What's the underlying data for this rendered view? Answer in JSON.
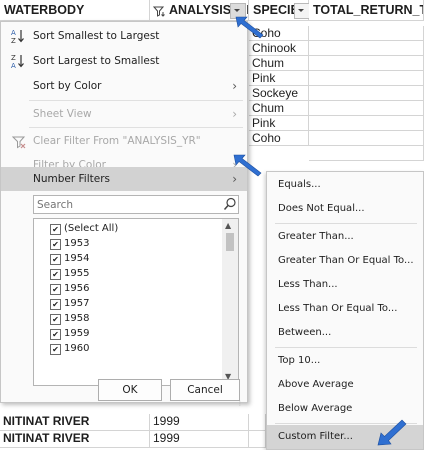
{
  "columns": [
    {
      "name": "WATERBODY"
    },
    {
      "name": "ANALYSIS_YR"
    },
    {
      "name": "SPECIES"
    },
    {
      "name": "TOTAL_RETURN_TO"
    }
  ],
  "species_cells": [
    "Coho",
    "Chinook",
    "Chum",
    "Pink",
    "Sockeye",
    "Chum",
    "Pink",
    "Coho"
  ],
  "bottom_rows": [
    {
      "waterbody": "NITINAT RIVER",
      "year": "1999"
    },
    {
      "waterbody": "NITINAT RIVER",
      "year": "1999"
    }
  ],
  "menu": {
    "sort_asc": "Sort Smallest to Largest",
    "sort_desc": "Sort Largest to Smallest",
    "sort_color": "Sort by Color",
    "sheet_view": "Sheet View",
    "clear_filter": "Clear Filter From \"ANALYSIS_YR\"",
    "filter_color": "Filter by Color",
    "number_filters": "Number Filters",
    "search_placeholder": "Search",
    "ok": "OK",
    "cancel": "Cancel"
  },
  "list_items": [
    "(Select All)",
    "1953",
    "1954",
    "1955",
    "1956",
    "1957",
    "1958",
    "1959",
    "1960"
  ],
  "submenu": [
    "Equals...",
    "Does Not Equal...",
    "Greater Than...",
    "Greater Than Or Equal To...",
    "Less Than...",
    "Less Than Or Equal To...",
    "Between...",
    "Top 10...",
    "Above Average",
    "Below Average",
    "Custom Filter..."
  ],
  "colors": {
    "arrow": "#2f6fd1",
    "highlight": "#d2d2d2",
    "border": "#c6c6c6"
  }
}
